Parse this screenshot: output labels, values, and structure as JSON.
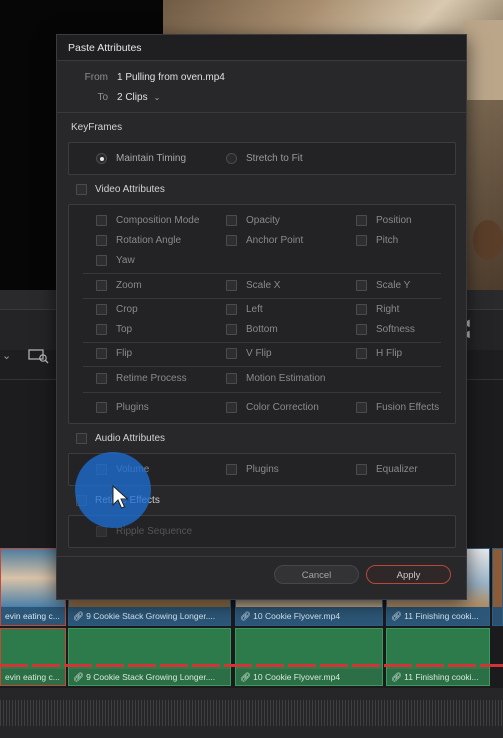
{
  "dialog": {
    "title": "Paste Attributes",
    "from_label": "From",
    "from_value": "1 Pulling from oven.mp4",
    "to_label": "To",
    "to_value": "2 Clips",
    "keyframes": {
      "label": "KeyFrames",
      "options": [
        {
          "label": "Maintain Timing",
          "selected": true
        },
        {
          "label": "Stretch to Fit",
          "selected": false
        }
      ]
    },
    "video": {
      "label": "Video Attributes",
      "rows": [
        [
          "Composition Mode",
          "Opacity",
          "Position"
        ],
        [
          "Rotation Angle",
          "Anchor Point",
          "Pitch"
        ],
        [
          "Yaw",
          "",
          ""
        ],
        [
          "Zoom",
          "Scale X",
          "Scale Y"
        ],
        [
          "Crop",
          "Left",
          "Right"
        ],
        [
          "Top",
          "Bottom",
          "Softness"
        ],
        [
          "Flip",
          "V Flip",
          "H Flip"
        ],
        [
          "Retime Process",
          "Motion Estimation",
          ""
        ],
        [
          "Plugins",
          "Color Correction",
          "Fusion Effects"
        ]
      ]
    },
    "audio": {
      "label": "Audio Attributes",
      "items": [
        "Volume",
        "Plugins",
        "Equalizer"
      ]
    },
    "retime": {
      "label": "Retime Effects",
      "items": [
        "Ripple Sequence"
      ]
    },
    "buttons": {
      "cancel": "Cancel",
      "apply": "Apply"
    }
  },
  "timeline": {
    "video_clips": [
      "evin eating c...",
      "9 Cookie Stack Growing Longer....",
      "10 Cookie Flyover.mp4",
      "11 Finishing cooki..."
    ],
    "audio_clips": [
      "evin eating c...",
      "9 Cookie Stack Growing Longer....",
      "10 Cookie Flyover.mp4",
      "11 Finishing cooki..."
    ]
  },
  "colors": {
    "accent_apply_border": "#b5493a",
    "video_clip": "#2c5778",
    "audio_clip": "#2d7a4a",
    "cursor_highlight": "#1e6ed2"
  }
}
